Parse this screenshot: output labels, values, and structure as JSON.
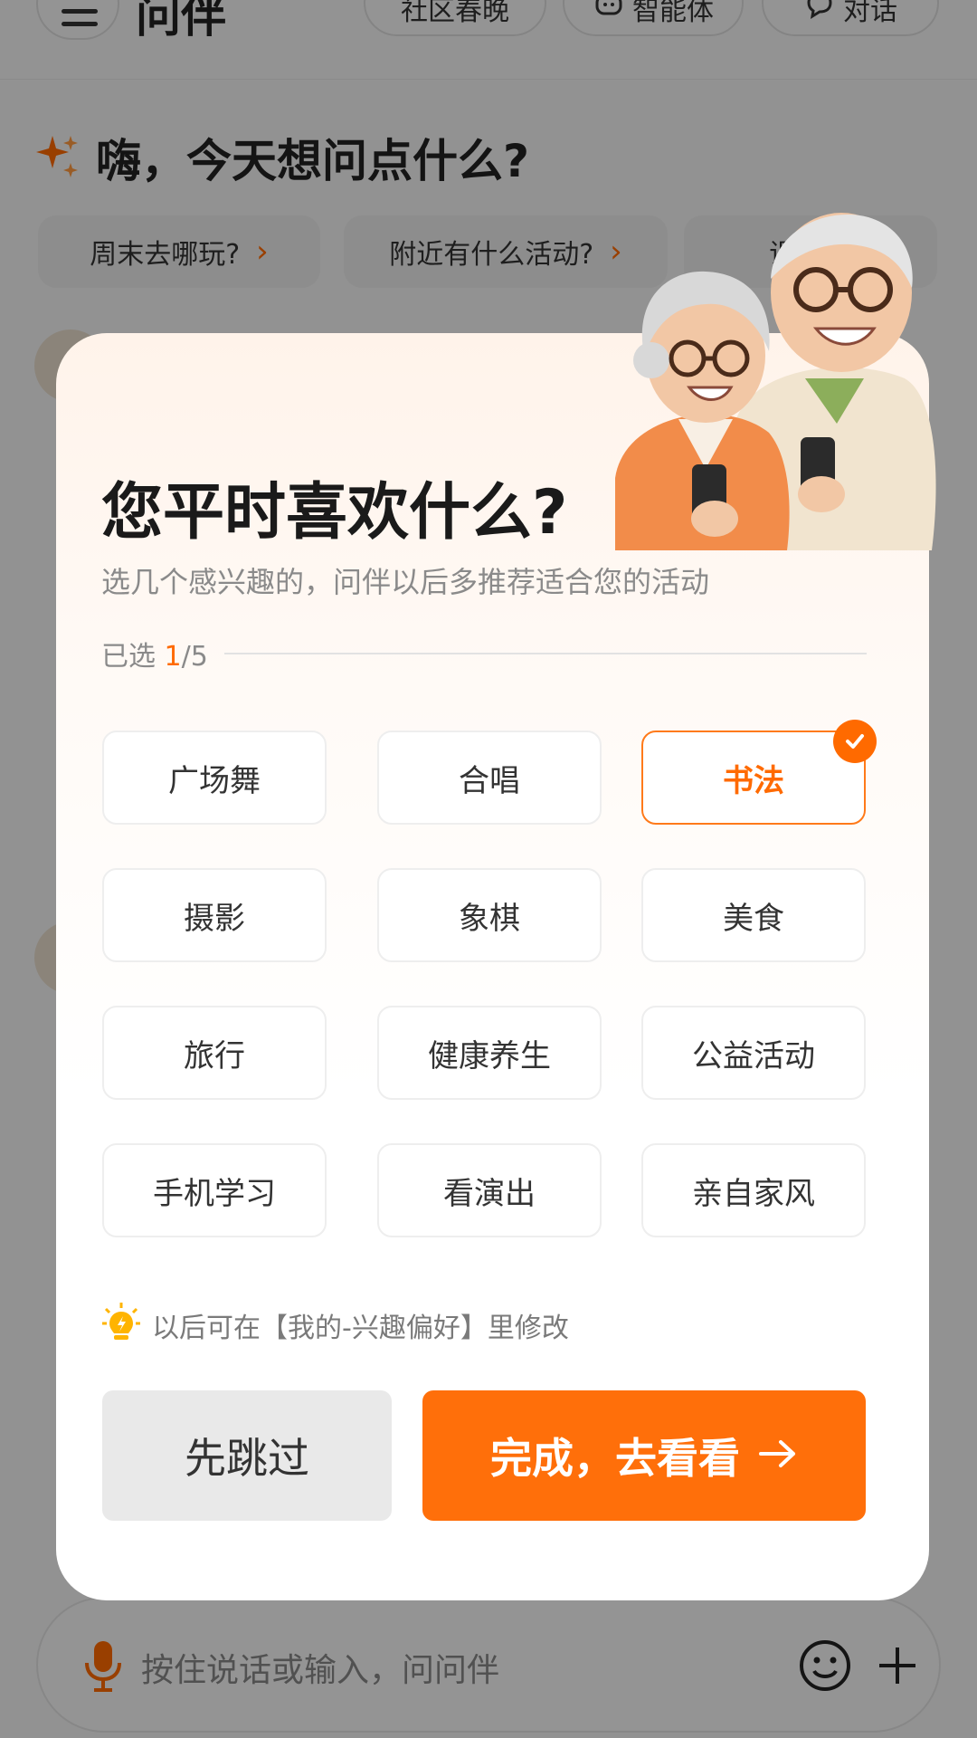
{
  "app": {
    "title": "问伴",
    "header_pills": [
      {
        "label": "社区春晚",
        "icon": "none"
      },
      {
        "label": "智能体",
        "icon": "agent-icon"
      },
      {
        "label": "对话",
        "icon": "chat-bubble-icon"
      }
    ],
    "greeting": "嗨，今天想问点什么?",
    "suggestion_chips": [
      {
        "label": "周末去哪玩?"
      },
      {
        "label": "附近有什么活动?"
      },
      {
        "label": "课程"
      }
    ],
    "input_placeholder": "按住说话或输入，问问伴"
  },
  "modal": {
    "title": "您平时喜欢什么?",
    "subtitle": "选几个感兴趣的，问伴以后多推荐适合您的活动",
    "count_prefix": "已选 ",
    "count_selected": "1",
    "count_total": "/5",
    "options": [
      {
        "label": "广场舞",
        "selected": false
      },
      {
        "label": "合唱",
        "selected": false
      },
      {
        "label": "书法",
        "selected": true
      },
      {
        "label": "摄影",
        "selected": false
      },
      {
        "label": "象棋",
        "selected": false
      },
      {
        "label": "美食",
        "selected": false
      },
      {
        "label": "旅行",
        "selected": false
      },
      {
        "label": "健康养生",
        "selected": false
      },
      {
        "label": "公益活动",
        "selected": false
      },
      {
        "label": "手机学习",
        "selected": false
      },
      {
        "label": "看演出",
        "selected": false
      },
      {
        "label": "亲自家风",
        "selected": false
      }
    ],
    "tip": "以后可在【我的-兴趣偏好】里修改",
    "skip_label": "先跳过",
    "done_label": "完成，去看看"
  },
  "colors": {
    "accent": "#ff6a00",
    "button_primary": "#ff6f0a",
    "button_secondary": "#e9e9e9",
    "tip_icon": "#ffb400"
  }
}
